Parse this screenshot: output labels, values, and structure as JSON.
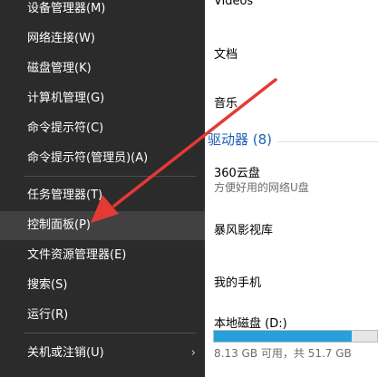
{
  "winx_menu": {
    "items": [
      {
        "label": "设备管理器(M)"
      },
      {
        "label": "网络连接(W)"
      },
      {
        "label": "磁盘管理(K)"
      },
      {
        "label": "计算机管理(G)"
      },
      {
        "label": "命令提示符(C)"
      },
      {
        "label": "命令提示符(管理员)(A)"
      },
      {
        "label": "任务管理器(T)"
      },
      {
        "label": "控制面板(P)",
        "highlighted": true
      },
      {
        "label": "文件资源管理器(E)"
      },
      {
        "label": "搜索(S)"
      },
      {
        "label": "运行(R)"
      },
      {
        "label": "关机或注销(U)",
        "submenu_arrow": "›"
      }
    ]
  },
  "explorer": {
    "folders": [
      {
        "label": "Videos"
      },
      {
        "label": "文档"
      },
      {
        "label": "音乐"
      }
    ],
    "section_header": "驱动器 (8)",
    "drives": [
      {
        "name": "360云盘",
        "subtitle": "方便好用的网络U盘"
      },
      {
        "name": "暴风影视库"
      },
      {
        "name": "我的手机"
      },
      {
        "name": "本地磁盘 (D:)",
        "space": "8.13 GB 可用，共 51.7 GB",
        "used_fraction": 0.843
      }
    ]
  },
  "colors": {
    "menu_bg": "#2b2b2b",
    "menu_highlight": "#414141",
    "section_header": "#1e5fb4",
    "drive_bar_fill": "#26a0da",
    "annotation_arrow": "#e53935"
  }
}
